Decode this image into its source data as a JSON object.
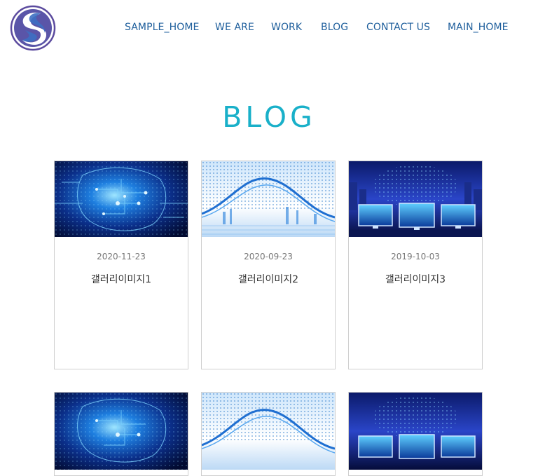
{
  "header": {
    "logo_icon": "s-logo-icon",
    "nav": [
      {
        "label": "SAMPLE_HOME"
      },
      {
        "label": "WE ARE"
      },
      {
        "label": "WORK"
      },
      {
        "label": "BLOG"
      },
      {
        "label": "CONTACT US"
      },
      {
        "label": "MAIN_HOME"
      }
    ]
  },
  "page": {
    "title": "BLOG"
  },
  "gallery": {
    "row1": [
      {
        "date": "2020-11-23",
        "title": "갤러리이미지1",
        "image": "ai-brain-circuit"
      },
      {
        "date": "2020-09-23",
        "title": "갤러리이미지2",
        "image": "world-map-network"
      },
      {
        "date": "2019-10-03",
        "title": "갤러리이미지3",
        "image": "monitors-city-night"
      }
    ],
    "row2": [
      {
        "image": "ai-brain-circuit"
      },
      {
        "image": "world-map-network"
      },
      {
        "image": "monitors-city-night"
      }
    ]
  },
  "colors": {
    "accent": "#19b0c9",
    "nav": "#1f5f9c",
    "logo_ring": "#5a4a9c",
    "logo_blue": "#3a66b8"
  }
}
